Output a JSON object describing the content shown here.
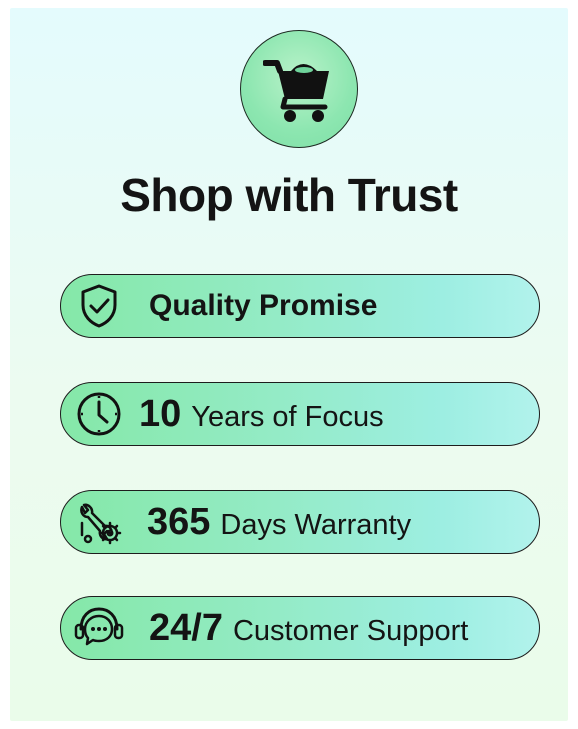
{
  "title": "Shop with Trust",
  "logo_icon": "shopping-cart-icon",
  "features": [
    {
      "icon": "shield-check-icon",
      "number": "",
      "label": "Quality Promise"
    },
    {
      "icon": "clock-icon",
      "number": "10",
      "label": "Years of Focus"
    },
    {
      "icon": "wrench-gear-icon",
      "number": "365",
      "label": "Days Warranty"
    },
    {
      "icon": "headset-chat-icon",
      "number": "24/7",
      "label": "Customer Support"
    }
  ],
  "colors": {
    "background_top": "#e4fbfd",
    "background_bottom": "#eafcea",
    "pill_start": "#85e8a8",
    "pill_end": "#b2f3ec",
    "text": "#141414"
  }
}
